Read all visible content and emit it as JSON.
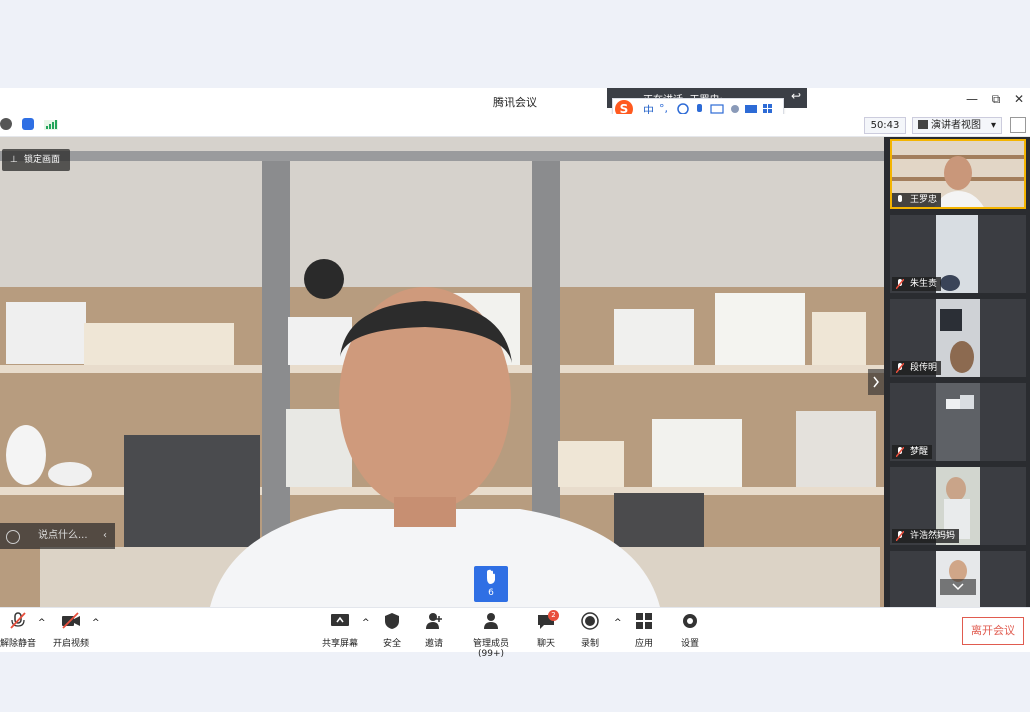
{
  "window": {
    "title": "腾讯会议",
    "minimize": "—",
    "restore": "⧉",
    "close": "✕"
  },
  "speaking": {
    "text": "正在讲话: 王罗忠;",
    "back": "↩"
  },
  "ime": {
    "logo": "S",
    "lang": "中",
    "punct": "°,"
  },
  "infobar": {
    "timer": "50:43",
    "view_label": "演讲者视图",
    "view_caret": "▾"
  },
  "video": {
    "lock_label": "锁定画面",
    "chat_placeholder": "说点什么...",
    "raise_hand_count": "6"
  },
  "participants": [
    {
      "name": "王罗忠"
    },
    {
      "name": "朱生贵"
    },
    {
      "name": "段传明"
    },
    {
      "name": "梦醒"
    },
    {
      "name": "许浩然妈妈"
    },
    {
      "name": ""
    }
  ],
  "toolbar": {
    "unmute": "解除静音",
    "start_video": "开启视频",
    "share": "共享屏幕",
    "security": "安全",
    "invite": "邀请",
    "manage": "管理成员(99+)",
    "chat": "聊天",
    "chat_badge": "2",
    "record": "录制",
    "apps": "应用",
    "settings": "设置",
    "leave": "离开会议"
  },
  "colors": {
    "accent": "#2f6fe4",
    "leave": "#e05b4f",
    "badge": "#e84e3c"
  }
}
